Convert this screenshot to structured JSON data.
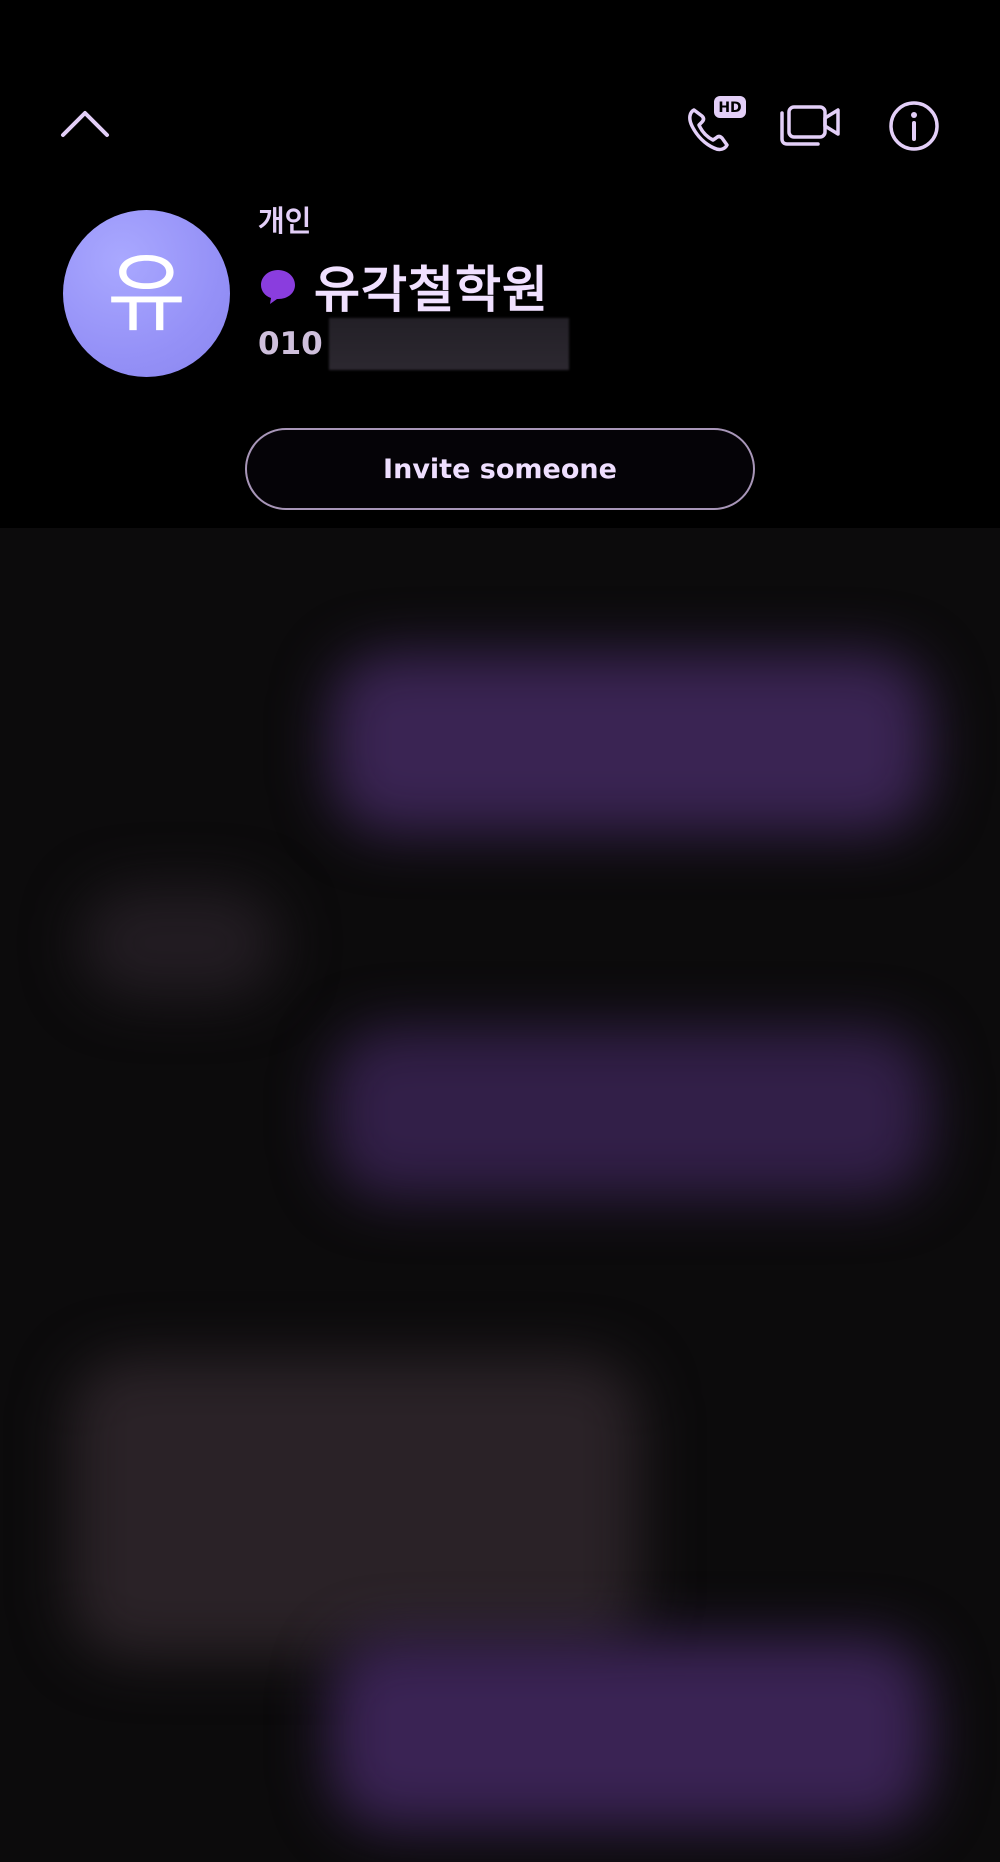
{
  "header": {
    "back_icon": "chevron-up-icon",
    "actions": {
      "hd_call_icon": "hd-voice-call-icon",
      "hd_badge": "HD",
      "video_call_icon": "video-call-icon",
      "info_icon": "info-icon"
    }
  },
  "profile": {
    "avatar_initial": "유",
    "category": "개인",
    "talk_icon": "talk-bubble-icon",
    "name": "유각철학원",
    "phone_prefix": "010",
    "accent_color": "#8a3dde",
    "avatar_color": "#9591f7"
  },
  "invite": {
    "label": "Invite someone"
  },
  "chat": {
    "state": "blurred"
  }
}
